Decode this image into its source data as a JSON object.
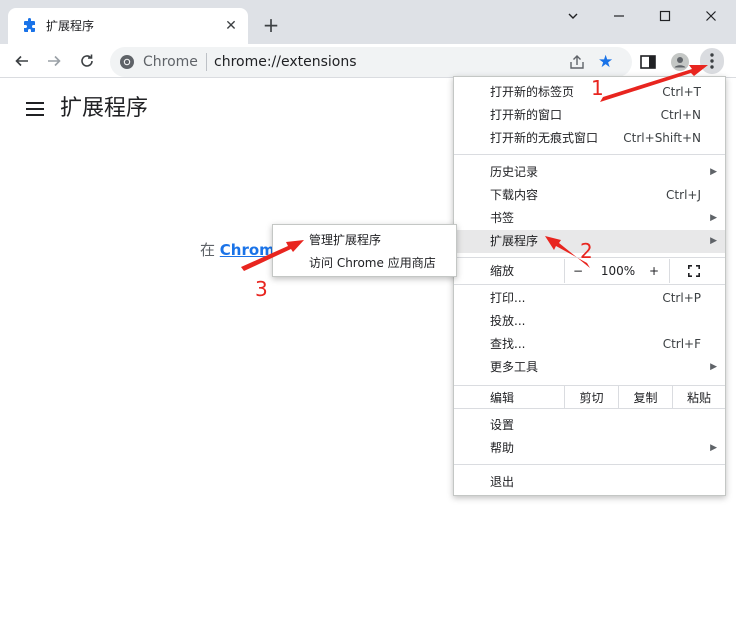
{
  "tab": {
    "title": "扩展程序",
    "close": "✕"
  },
  "newtab": "+",
  "window": {
    "minimize": "⌄",
    "restore": "—",
    "maximize": "☐",
    "close": "✕"
  },
  "omnibox": {
    "site_label": "Chrome",
    "url": "chrome://extensions"
  },
  "page": {
    "title": "扩展程序",
    "hint_prefix": "在",
    "hint_link": "Chrome"
  },
  "menu": {
    "items_top": [
      {
        "label": "打开新的标签页",
        "shortcut": "Ctrl+T"
      },
      {
        "label": "打开新的窗口",
        "shortcut": "Ctrl+N"
      },
      {
        "label": "打开新的无痕式窗口",
        "shortcut": "Ctrl+Shift+N"
      }
    ],
    "items_mid": [
      {
        "label": "历史记录",
        "shortcut": ""
      },
      {
        "label": "下载内容",
        "shortcut": "Ctrl+J"
      },
      {
        "label": "书签",
        "shortcut": ""
      },
      {
        "label": "扩展程序",
        "shortcut": ""
      }
    ],
    "zoom": {
      "label": "缩放",
      "minus": "−",
      "value": "100%",
      "plus": "+"
    },
    "items_tools": [
      {
        "label": "打印...",
        "shortcut": "Ctrl+P"
      },
      {
        "label": "投放...",
        "shortcut": ""
      },
      {
        "label": "查找...",
        "shortcut": "Ctrl+F"
      },
      {
        "label": "更多工具",
        "shortcut": ""
      }
    ],
    "edit": {
      "label": "编辑",
      "cut": "剪切",
      "copy": "复制",
      "paste": "粘贴"
    },
    "items_settings": [
      {
        "label": "设置"
      },
      {
        "label": "帮助"
      }
    ],
    "exit": "退出",
    "submenu_arrow": "▶"
  },
  "submenu": {
    "items": [
      {
        "label": "管理扩展程序"
      },
      {
        "label": "访问 Chrome 应用商店"
      }
    ]
  },
  "annotations": {
    "n1": "1",
    "n2": "2",
    "n3": "3",
    "color": "#e8251f"
  },
  "colors": {
    "accent": "#1a73e8",
    "tabstrip": "#dee1e6"
  }
}
